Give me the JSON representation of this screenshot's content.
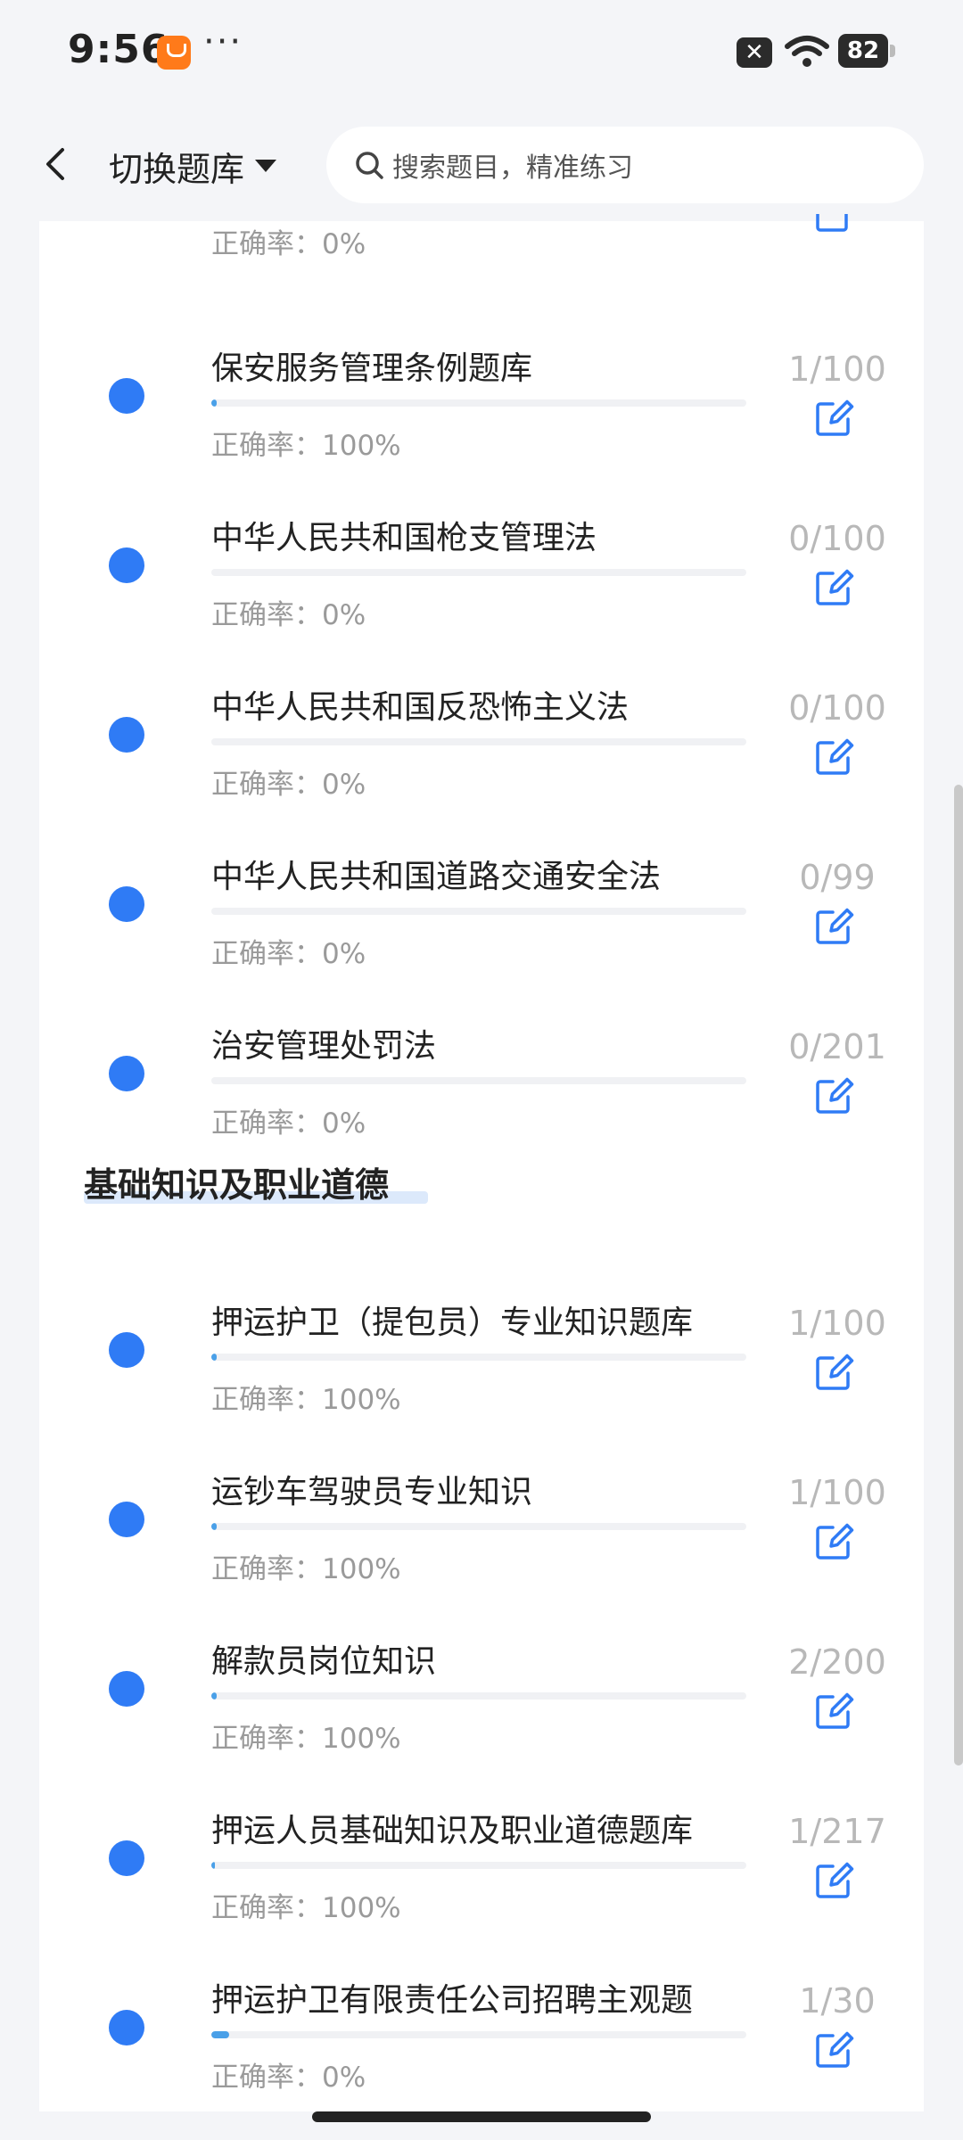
{
  "status_bar": {
    "time": "9:56",
    "more": "···",
    "close_glyph": "✕",
    "battery": "82"
  },
  "header": {
    "switch_label": "切换题库",
    "search_placeholder": "搜索题目，精准练习"
  },
  "partial_row": {
    "accuracy": "正确率：0%"
  },
  "groups": [
    {
      "items": [
        {
          "title": "保安服务管理条例题库",
          "accuracy": "正确率：100%",
          "count": "1/100",
          "progress": 0.01
        },
        {
          "title": "中华人民共和国枪支管理法",
          "accuracy": "正确率：0%",
          "count": "0/100",
          "progress": 0
        },
        {
          "title": "中华人民共和国反恐怖主义法",
          "accuracy": "正确率：0%",
          "count": "0/100",
          "progress": 0
        },
        {
          "title": "中华人民共和国道路交通安全法",
          "accuracy": "正确率：0%",
          "count": "0/99",
          "progress": 0
        },
        {
          "title": "治安管理处罚法",
          "accuracy": "正确率：0%",
          "count": "0/201",
          "progress": 0
        }
      ]
    },
    {
      "section_title": "基础知识及职业道德",
      "items": [
        {
          "title": "押运护卫（提包员）专业知识题库",
          "accuracy": "正确率：100%",
          "count": "1/100",
          "progress": 0.01
        },
        {
          "title": "运钞车驾驶员专业知识",
          "accuracy": "正确率：100%",
          "count": "1/100",
          "progress": 0.01
        },
        {
          "title": "解款员岗位知识",
          "accuracy": "正确率：100%",
          "count": "2/200",
          "progress": 0.01
        },
        {
          "title": "押运人员基础知识及职业道德题库",
          "accuracy": "正确率：100%",
          "count": "1/217",
          "progress": 0.005
        },
        {
          "title": "押运护卫有限责任公司招聘主观题",
          "accuracy": "正确率：0%",
          "count": "1/30",
          "progress": 0.033
        }
      ]
    }
  ],
  "icons": {
    "back": "back-arrow-icon",
    "caret": "caret-down-icon",
    "search": "search-icon",
    "edit": "edit-icon",
    "dot": "status-dot-icon"
  },
  "colors": {
    "accent": "#2f7bf5",
    "progress": "#4aa0e8",
    "muted": "#9a9a9a"
  }
}
